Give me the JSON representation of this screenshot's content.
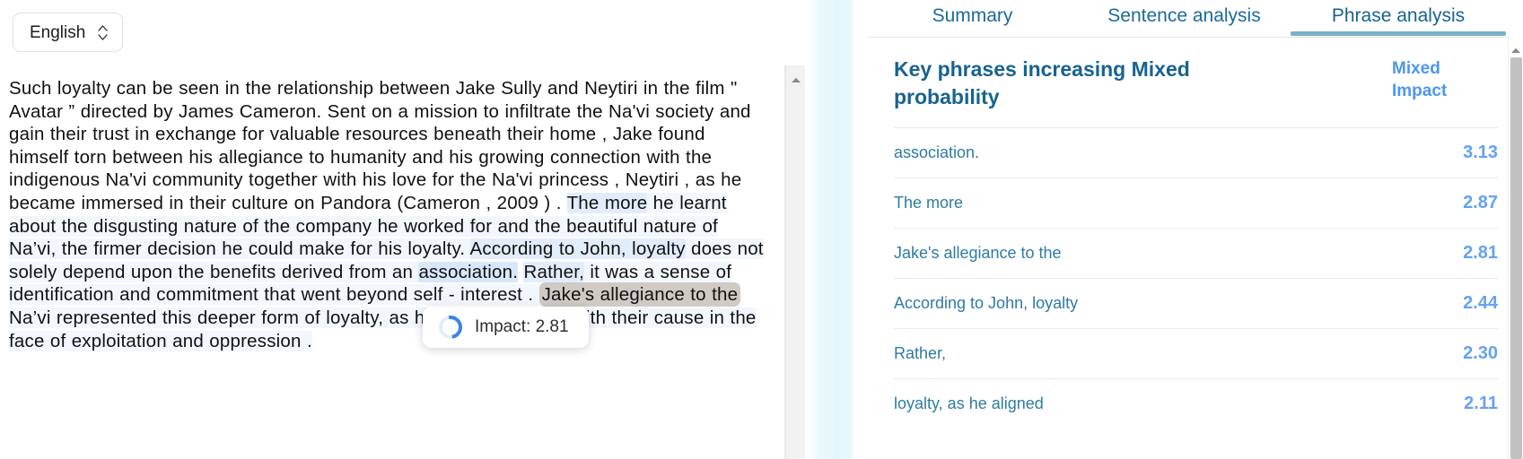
{
  "language_selector": {
    "value": "English",
    "icon": "chevron-updown-icon"
  },
  "document": {
    "segments": [
      {
        "text": "Such loyalty can be seen in the relationship between Jake Sully and Neytiri in the film \" Avatar ” directed by James Cameron. Sent on a mission to infiltrate the Na'vi society and gain their trust in exchange for valuable resources beneath their home , Jake found himself torn between his allegiance to humanity and his growing connection with the indigenous Na'vi community together with his love for the Na'vi princess , Neytiri , as he became immersed in their culture on Pandora (Cameron , 2009 ) . ",
        "highlight": "none"
      },
      {
        "text": "The more",
        "highlight": "medium"
      },
      {
        "text": " he learnt about the disgusting nature of the company he worked for and the beautiful nature of Na’vi, the firmer decision he could make for his loyalty. ",
        "highlight": "light"
      },
      {
        "text": "According to John, loyalty",
        "highlight": "medium"
      },
      {
        "text": " does not solely depend upon the benefits derived from an ",
        "highlight": "light"
      },
      {
        "text": "association.",
        "highlight": "strong"
      },
      {
        "text": " ",
        "highlight": "none"
      },
      {
        "text": "Rather,",
        "highlight": "medium"
      },
      {
        "text": " it was a sense of identification and commitment that went beyond self - interest . ",
        "highlight": "light"
      },
      {
        "text": "Jake's allegiance to the",
        "highlight": "hover"
      },
      {
        "text": " Na’vi represented this deeper form of ",
        "highlight": "light"
      },
      {
        "text": "loyalty, as he aligned",
        "highlight": "light"
      },
      {
        "text": " himself with their cause in the face of exploitation and oppression .",
        "highlight": "light"
      }
    ]
  },
  "tooltip": {
    "label": "Impact: 2.81",
    "icon": "loading-spinner-icon"
  },
  "tabs": [
    {
      "id": "summary",
      "label": "Summary",
      "active": false
    },
    {
      "id": "sentence-analysis",
      "label": "Sentence analysis",
      "active": false
    },
    {
      "id": "phrase-analysis",
      "label": "Phrase analysis",
      "active": true
    }
  ],
  "panel": {
    "title": "Key phrases increasing Mixed probability",
    "metric_header": "Mixed Impact",
    "rows": [
      {
        "phrase": "association.",
        "value": "3.13"
      },
      {
        "phrase": "The more",
        "value": "2.87"
      },
      {
        "phrase": "Jake's allegiance to the",
        "value": "2.81"
      },
      {
        "phrase": "According to John, loyalty",
        "value": "2.44"
      },
      {
        "phrase": "Rather,",
        "value": "2.30"
      },
      {
        "phrase": "loyalty, as he aligned",
        "value": "2.11"
      }
    ]
  },
  "colors": {
    "tab_active_underline": "#77b2c7",
    "panel_title": "#176390",
    "metric_blue": "#4d96f0",
    "phrase_blue": "#2e7ba3",
    "cyan_strip": "#e3f7fa",
    "hover_highlight": "#cfcac3",
    "spinner_blue": "#3b82ea"
  }
}
